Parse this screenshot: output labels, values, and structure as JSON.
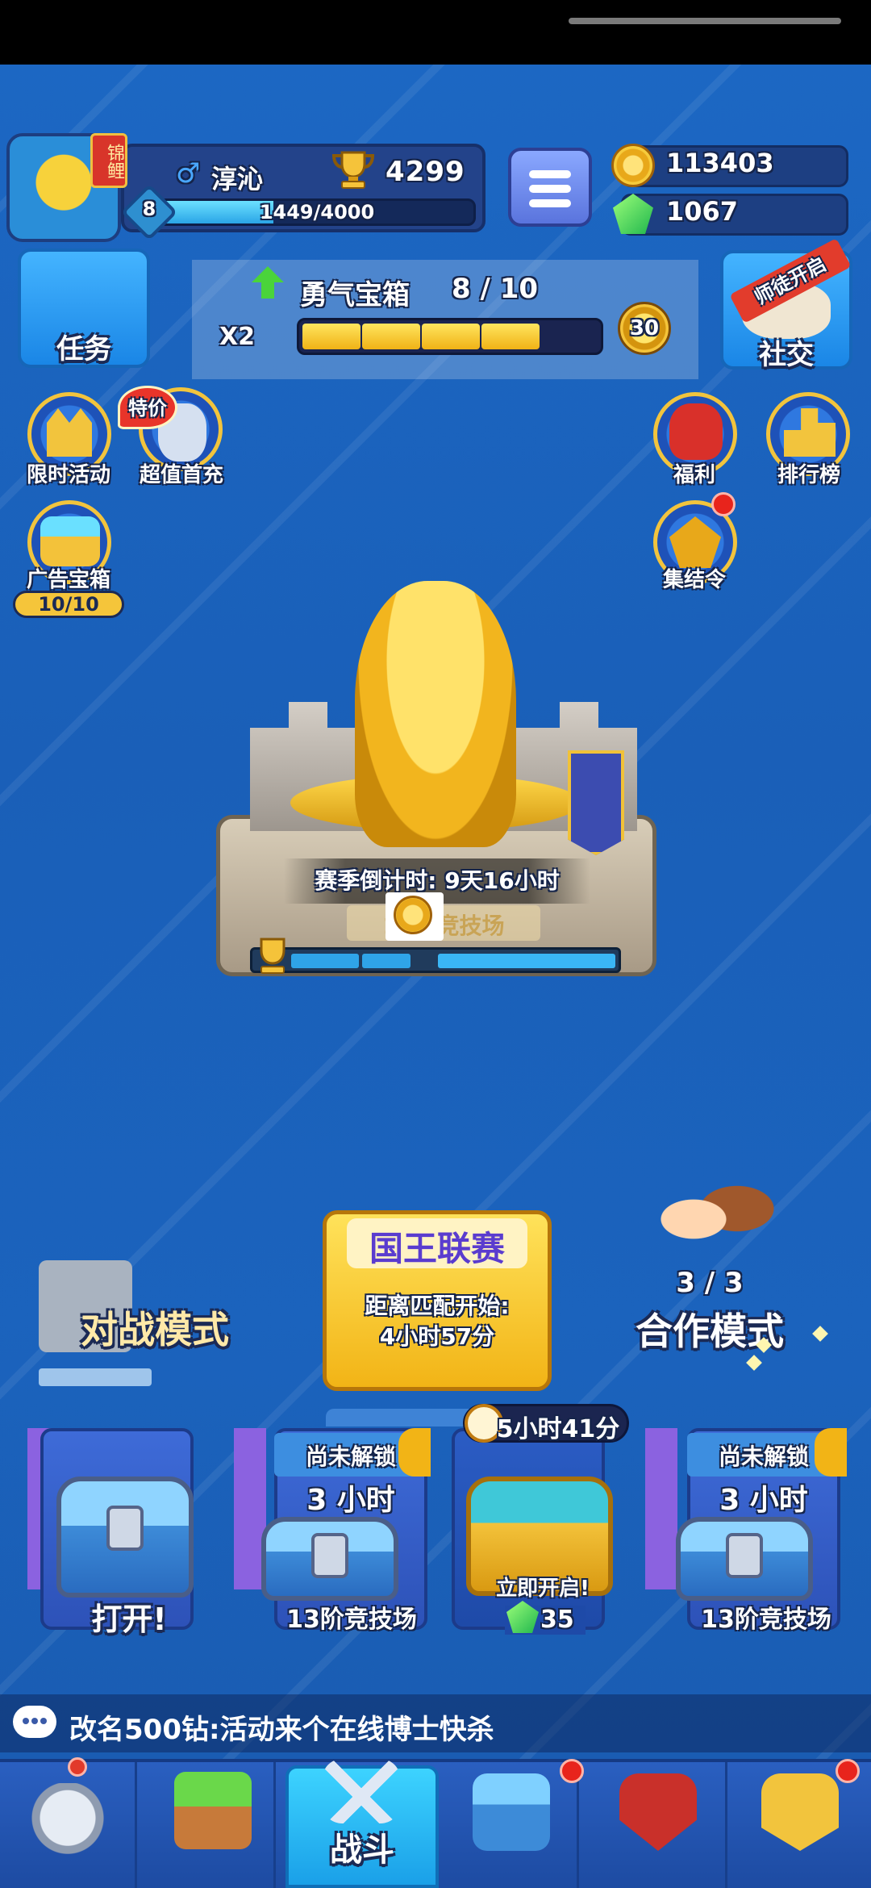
{
  "player": {
    "koi_tag": "锦鲤",
    "gender_symbol": "♂",
    "name": "淳沁",
    "trophies": "4299",
    "level": "8",
    "xp_text": "1449/4000",
    "xp_fraction": 0.362
  },
  "currency": {
    "gold": "113403",
    "gems": "1067"
  },
  "buttons": {
    "task": "任务",
    "social": "社交",
    "social_ribbon": "师徒开启"
  },
  "courage_chest": {
    "title": "勇气宝箱",
    "progress": "8 / 10",
    "multiplier": "X2",
    "filled_segments": 4,
    "total_segments": 5,
    "coin_value": "30"
  },
  "side_left": [
    {
      "label": "限时活动"
    },
    {
      "label": "超值首充",
      "badge": "特价"
    },
    {
      "label": "广告宝箱",
      "count": "10/10"
    }
  ],
  "side_right": [
    {
      "label": "福利"
    },
    {
      "label": "排行榜"
    },
    {
      "label": "集结令"
    }
  ],
  "arena": {
    "countdown": "赛季倒计时: 9天16小时",
    "name": "13阶竞技场"
  },
  "modes": {
    "battle": "对战模式",
    "king_league": {
      "title": "国王联赛",
      "line1": "距离匹配开始:",
      "line2": "4小时57分"
    },
    "coop": {
      "count": "3 / 3",
      "label": "合作模式"
    }
  },
  "chest_slots": [
    {
      "label": "打开!"
    },
    {
      "locked_label": "尚未解锁",
      "time": "3 小时",
      "label": "13阶竞技场"
    },
    {
      "timer": "5小时41分",
      "open_label": "立即开启!",
      "gem_cost": "35"
    },
    {
      "locked_label": "尚未解锁",
      "time": "3 小时",
      "label": "13阶竞技场"
    }
  ],
  "chat": {
    "message": "改名500钻:活动来个在线博士快杀"
  },
  "nav": {
    "active_label": "战斗"
  },
  "colors": {
    "background": "#1c68c4",
    "gold": "#f2b416",
    "notification": "#e8241c"
  }
}
